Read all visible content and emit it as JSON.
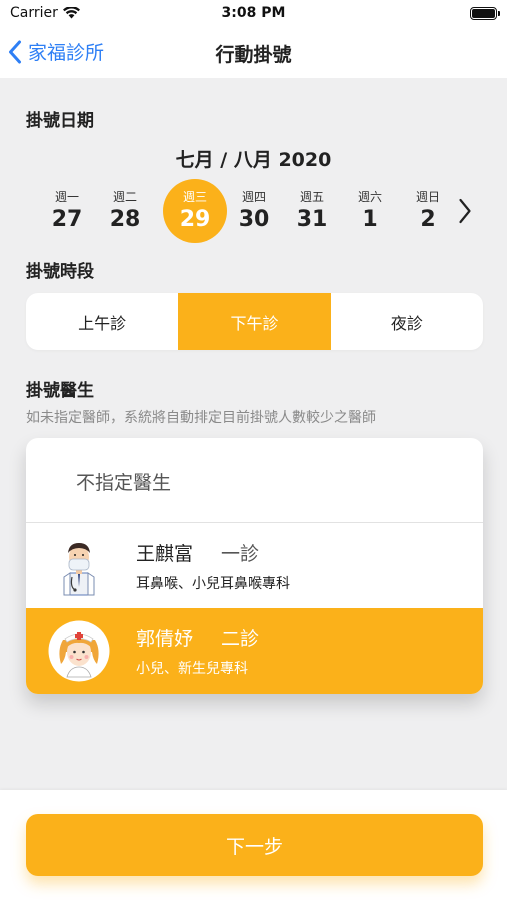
{
  "status_bar": {
    "carrier": "Carrier",
    "time": "3:08 PM"
  },
  "nav": {
    "back_label": "家福診所",
    "title": "行動掛號"
  },
  "date_section": {
    "label": "掛號日期",
    "month_title": "七月 / 八月 2020",
    "days": [
      {
        "weekday": "週一",
        "day": "27",
        "selected": false
      },
      {
        "weekday": "週二",
        "day": "28",
        "selected": false
      },
      {
        "weekday": "週三",
        "day": "29",
        "selected": true
      },
      {
        "weekday": "週四",
        "day": "30",
        "selected": false
      },
      {
        "weekday": "週五",
        "day": "31",
        "selected": false
      },
      {
        "weekday": "週六",
        "day": "1",
        "selected": false
      },
      {
        "weekday": "週日",
        "day": "2",
        "selected": false
      }
    ]
  },
  "session_section": {
    "label": "掛號時段",
    "options": [
      "上午診",
      "下午診",
      "夜診"
    ],
    "selected": "下午診"
  },
  "doctor_section": {
    "label": "掛號醫生",
    "hint": "如未指定醫師，系統將自動排定目前掛號人數較少之醫師",
    "no_doctor_label": "不指定醫生",
    "doctors": [
      {
        "name": "王麒富",
        "room": "一診",
        "specialty": "耳鼻喉、小兒耳鼻喉專科",
        "avatar": "male-doctor-avatar",
        "selected": false
      },
      {
        "name": "郭倩妤",
        "room": "二診",
        "specialty": "小兒、新生兒專科",
        "avatar": "female-nurse-avatar",
        "selected": true
      }
    ]
  },
  "footer": {
    "next_label": "下一步"
  },
  "colors": {
    "accent": "#fbb11a",
    "link": "#2e7ff5",
    "background": "#efeff0"
  }
}
